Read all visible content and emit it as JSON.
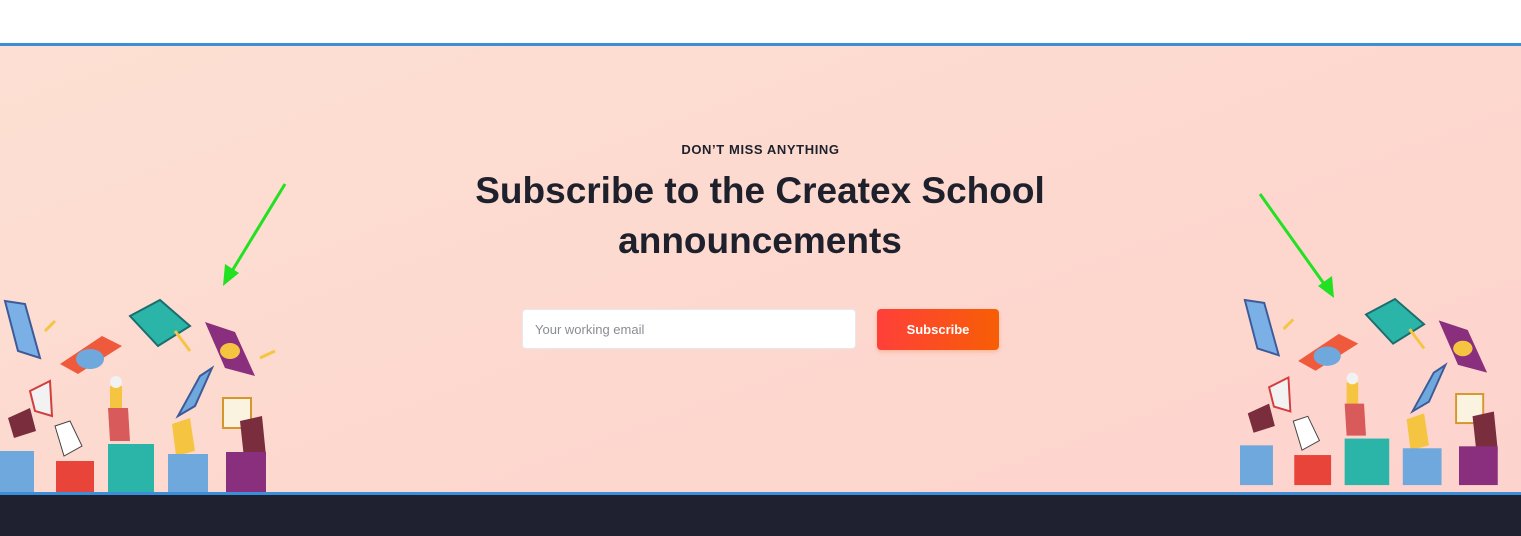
{
  "subscribe": {
    "eyebrow": "DON’T MISS ANYTHING",
    "heading_line1": "Subscribe to the Createx School",
    "heading_line2": "announcements",
    "email_placeholder": "Your working email",
    "button_label": "Subscribe"
  },
  "colors": {
    "banner_background": "#fdd8cf",
    "accent_line": "#3a8fd8",
    "button_gradient_start": "#ff3f3a",
    "button_gradient_end": "#f75e05",
    "heading_text": "#1e212c",
    "footer_background": "#1f2130",
    "annotation_arrow": "#22e022"
  },
  "icons": {
    "left_illustration": "graduation-caps-illustration",
    "right_illustration": "graduation-caps-illustration",
    "left_arrow": "annotation-arrow-icon",
    "right_arrow": "annotation-arrow-icon"
  }
}
